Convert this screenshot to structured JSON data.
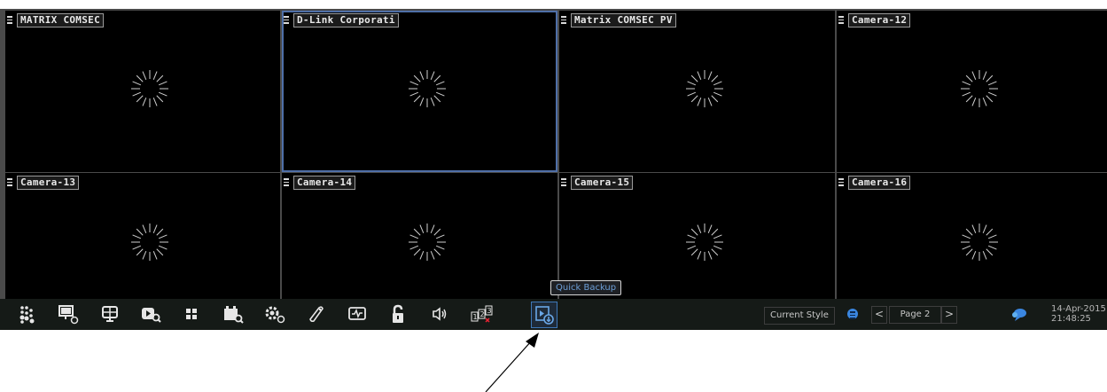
{
  "cameras": [
    {
      "title": "MATRIX COMSEC",
      "selected": false
    },
    {
      "title": "D-Link Corporati",
      "selected": true
    },
    {
      "title": "Matrix COMSEC PV",
      "selected": false
    },
    {
      "title": "Camera-12",
      "selected": false
    },
    {
      "title": "Camera-13",
      "selected": false
    },
    {
      "title": "Camera-14",
      "selected": false
    },
    {
      "title": "Camera-15",
      "selected": false
    },
    {
      "title": "Camera-16",
      "selected": false
    }
  ],
  "toolbar": {
    "icons": [
      "layout-dots-icon",
      "display-settings-icon",
      "monitor-icon",
      "playback-search-icon",
      "grid-layout-icon",
      "event-search-icon",
      "settings-icon",
      "tag-icon",
      "system-status-icon",
      "unlock-icon",
      "volume-icon",
      "sequence-icon",
      "quick-backup-icon"
    ],
    "active_icon": "quick-backup-icon"
  },
  "tooltip": "Quick Backup",
  "style": {
    "label": "Current Style"
  },
  "pagination": {
    "label": "Page 2",
    "prev": "<",
    "next": ">"
  },
  "datetime": {
    "date": "14-Apr-2015",
    "time": "21:48:25"
  },
  "colors": {
    "accent": "#3e78b8",
    "tooltip_text": "#6d9fd8",
    "selected_border": "#4f6fa8"
  }
}
